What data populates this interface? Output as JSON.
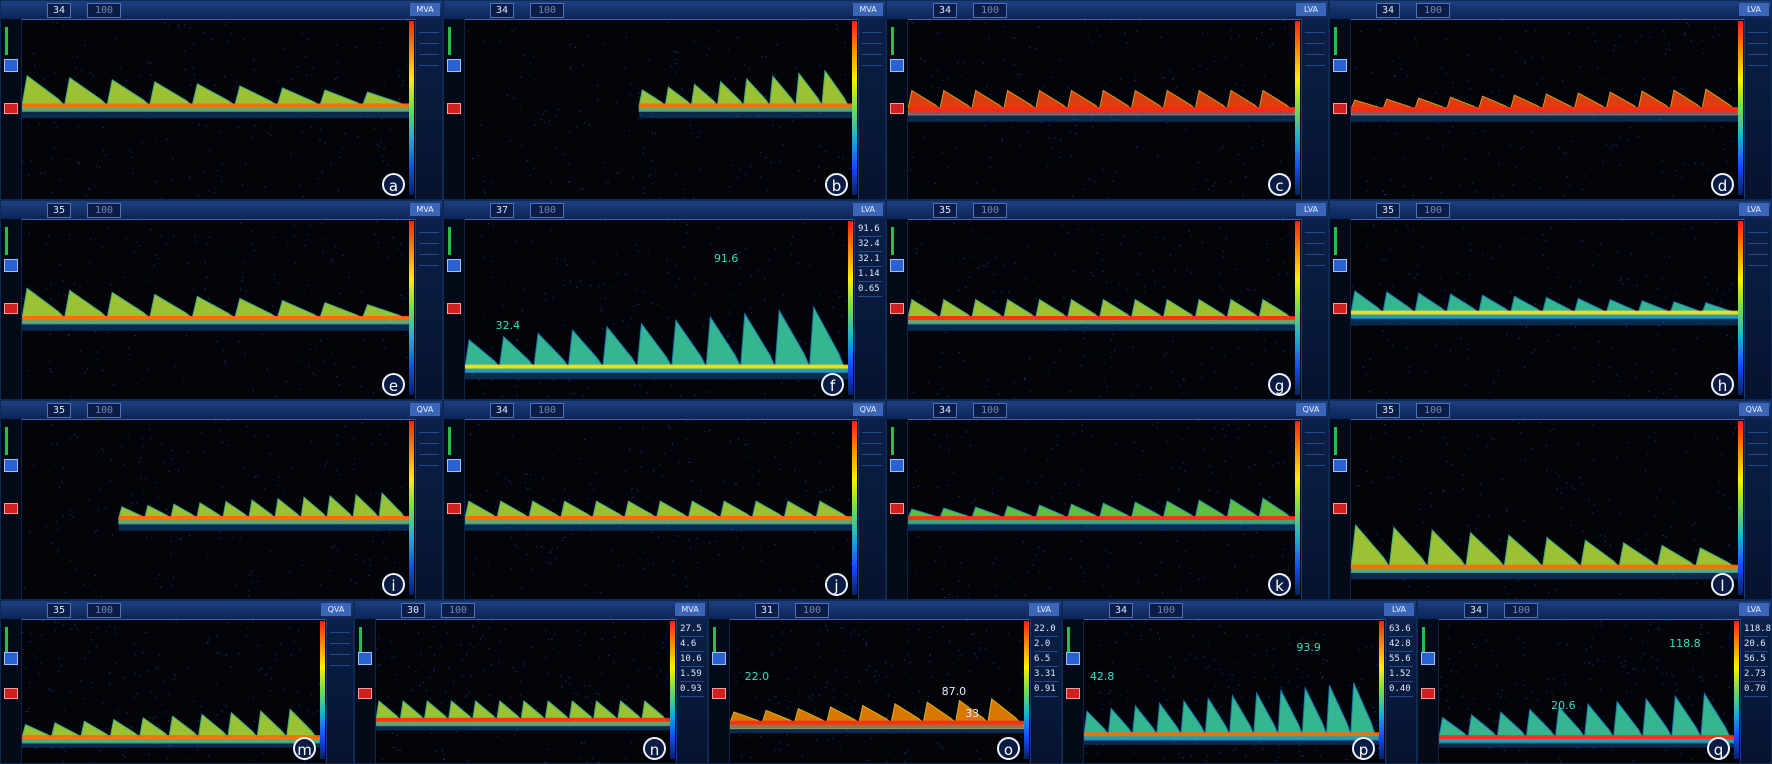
{
  "panels": [
    {
      "id": "a",
      "letter": "a",
      "field": "34",
      "dim": "100",
      "mode": "MVA",
      "values": [],
      "annotations": [],
      "colors": {
        "wave": "yellow-green",
        "band": "orange"
      }
    },
    {
      "id": "b",
      "letter": "b",
      "field": "34",
      "dim": "100",
      "mode": "MVA",
      "values": [],
      "annotations": [],
      "colors": {
        "wave": "yellow-green",
        "band": "orange"
      }
    },
    {
      "id": "c",
      "letter": "c",
      "field": "34",
      "dim": "100",
      "mode": "LVA",
      "values": [],
      "annotations": [],
      "colors": {
        "wave": "orange-red",
        "band": "red"
      }
    },
    {
      "id": "d",
      "letter": "d",
      "field": "34",
      "dim": "100",
      "mode": "LVA",
      "values": [],
      "annotations": [],
      "colors": {
        "wave": "orange-red",
        "band": "red"
      }
    },
    {
      "id": "e",
      "letter": "e",
      "field": "35",
      "dim": "100",
      "mode": "MVA",
      "values": [],
      "annotations": [],
      "colors": {
        "wave": "yellow-green",
        "band": "orange"
      }
    },
    {
      "id": "f",
      "letter": "f",
      "field": "37",
      "dim": "100",
      "mode": "LVA",
      "values": [
        "91.6",
        "32.4",
        "32.1",
        "1.14",
        "0.65"
      ],
      "annotations": [
        "91.6",
        "32.4"
      ],
      "colors": {
        "wave": "cyan-green",
        "band": "yellow"
      }
    },
    {
      "id": "g",
      "letter": "g",
      "field": "35",
      "dim": "100",
      "mode": "LVA",
      "values": [],
      "annotations": [],
      "colors": {
        "wave": "yellow-green",
        "band": "red"
      }
    },
    {
      "id": "h",
      "letter": "h",
      "field": "35",
      "dim": "100",
      "mode": "LVA",
      "values": [],
      "annotations": [],
      "colors": {
        "wave": "cyan-green",
        "band": "yellow"
      }
    },
    {
      "id": "i",
      "letter": "i",
      "field": "35",
      "dim": "100",
      "mode": "QVA",
      "values": [],
      "annotations": [],
      "colors": {
        "wave": "yellow-green",
        "band": "orange"
      }
    },
    {
      "id": "j",
      "letter": "j",
      "field": "34",
      "dim": "100",
      "mode": "QVA",
      "values": [],
      "annotations": [],
      "colors": {
        "wave": "yellow-green",
        "band": "orange"
      }
    },
    {
      "id": "k",
      "letter": "k",
      "field": "34",
      "dim": "100",
      "mode": "QVA",
      "values": [],
      "annotations": [],
      "colors": {
        "wave": "green",
        "band": "red"
      }
    },
    {
      "id": "l",
      "letter": "l",
      "field": "35",
      "dim": "100",
      "mode": "QVA",
      "values": [],
      "annotations": [],
      "colors": {
        "wave": "yellow-green",
        "band": "orange"
      }
    },
    {
      "id": "m",
      "letter": "m",
      "field": "35",
      "dim": "100",
      "mode": "QVA",
      "values": [],
      "annotations": [],
      "colors": {
        "wave": "yellow-green",
        "band": "orange"
      }
    },
    {
      "id": "n",
      "letter": "n",
      "field": "30",
      "dim": "100",
      "mode": "MVA",
      "values": [
        "27.5",
        "4.6",
        "10.6",
        "1.59",
        "0.93"
      ],
      "annotations": [],
      "colors": {
        "wave": "yellow-green",
        "band": "red"
      }
    },
    {
      "id": "o",
      "letter": "o",
      "field": "31",
      "dim": "100",
      "mode": "LVA",
      "values": [
        "22.0",
        "2.0",
        "6.5",
        "3.31",
        "0.91"
      ],
      "annotations": [
        "22.0",
        "87.0",
        "33"
      ],
      "colors": {
        "wave": "orange",
        "band": "red"
      }
    },
    {
      "id": "p",
      "letter": "p",
      "field": "34",
      "dim": "100",
      "mode": "LVA",
      "values": [
        "63.6",
        "42.8",
        "55.6",
        "1.52",
        "0.40"
      ],
      "annotations": [
        "42.8",
        "93.9"
      ],
      "colors": {
        "wave": "cyan-green",
        "band": "orange"
      }
    },
    {
      "id": "q",
      "letter": "q",
      "field": "34",
      "dim": "100",
      "mode": "LVA",
      "values": [
        "118.8",
        "20.6",
        "56.5",
        "2.73",
        "0.70"
      ],
      "annotations": [
        "118.8",
        "20.6"
      ],
      "colors": {
        "wave": "cyan-green",
        "band": "red"
      }
    }
  ]
}
